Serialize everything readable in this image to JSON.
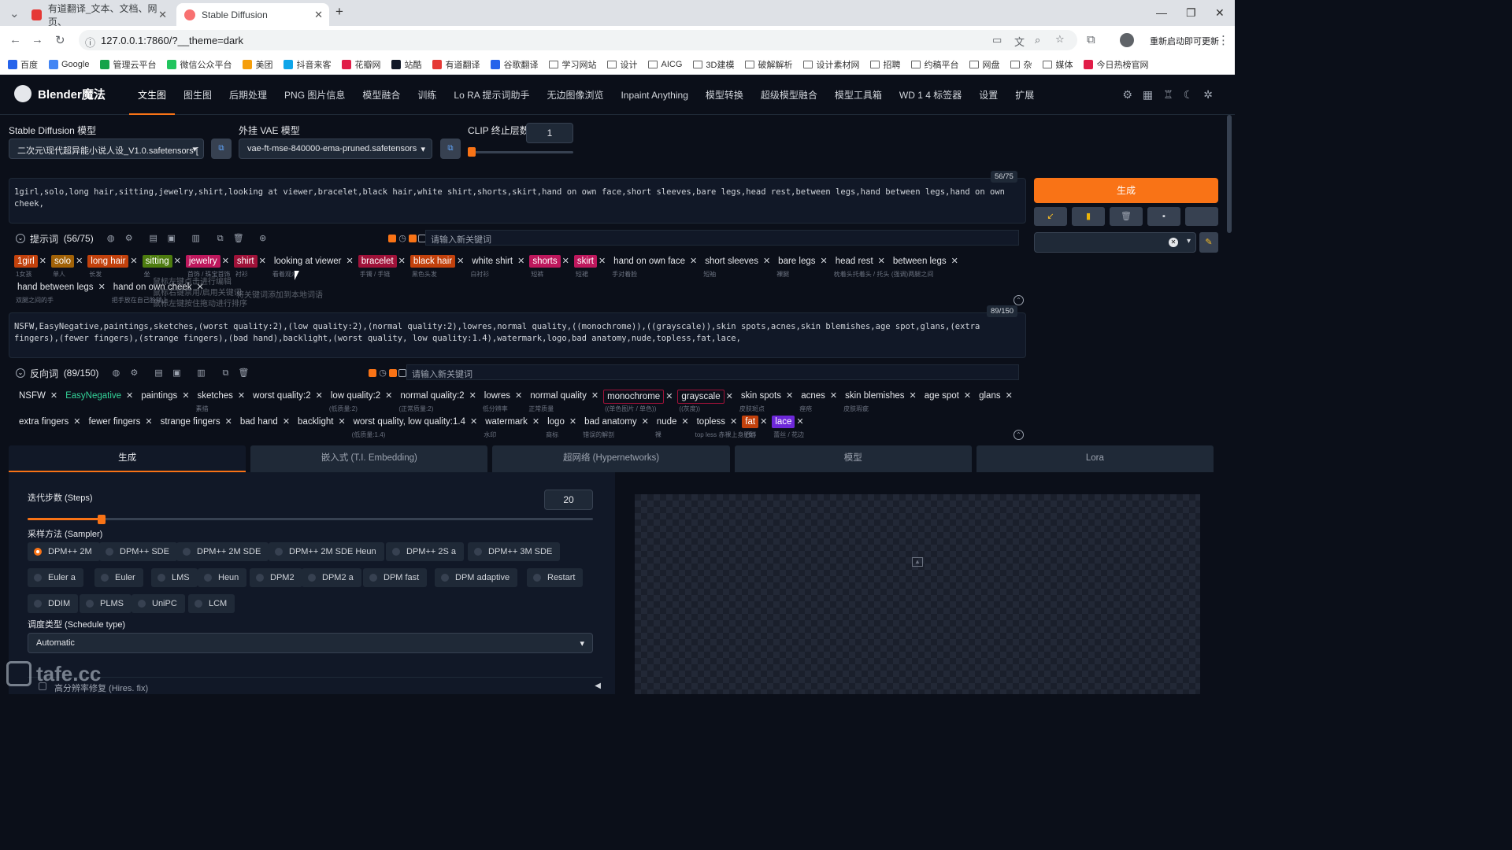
{
  "browser": {
    "tabs": [
      {
        "title": "有道翻译_文本、文档、网页、"
      },
      {
        "title": "Stable Diffusion"
      }
    ],
    "url": "127.0.0.1:7860/?__theme=dark",
    "update_label": "重新启动即可更新",
    "bookmarks": [
      "百度",
      "Google",
      "管理云平台",
      "微信公众平台",
      "美团",
      "抖音来客",
      "花瓣网",
      "站酷",
      "有道翻译",
      "谷歌翻译",
      "学习网站",
      "设计",
      "AICG",
      "3D建模",
      "破解解析",
      "设计素材网",
      "招聘",
      "约稿平台",
      "网盘",
      "杂",
      "媒体",
      "今日热榜官网"
    ]
  },
  "app": {
    "logo": "Blender魔法",
    "nav": [
      "文生图",
      "图生图",
      "后期处理",
      "PNG 图片信息",
      "模型融合",
      "训练",
      "Lo RA 提示词助手",
      "无边图像浏览",
      "Inpaint Anything",
      "模型转换",
      "超级模型融合",
      "模型工具箱",
      "WD 1 4 标签器",
      "设置",
      "扩展"
    ],
    "sd_model_label": "Stable Diffusion 模型",
    "sd_model_value": "二次元\\现代超异能小说人设_V1.0.safetensors [",
    "vae_label": "外挂 VAE 模型",
    "vae_value": "vae-ft-mse-840000-ema-pruned.safetensors",
    "clip_label": "CLIP 终止层数",
    "clip_value": "1",
    "clip_fraction": 0.0
  },
  "prompt": {
    "text": "1girl,solo,long hair,sitting,jewelry,shirt,looking at viewer,bracelet,black hair,white shirt,shorts,skirt,hand on own face,short sleeves,bare legs,head rest,between legs,hand between legs,hand on own cheek,",
    "counter": "56/75",
    "title": "提示词",
    "count": "(56/75)",
    "kw_placeholder": "请输入新关键词",
    "tags_row1": [
      {
        "t": "1girl",
        "s": "1女孩",
        "c": "orange"
      },
      {
        "t": "solo",
        "s": "单人",
        "c": "gold"
      },
      {
        "t": "long hair",
        "s": "长发",
        "c": "orange"
      },
      {
        "t": "sitting",
        "s": "坐",
        "c": "olive"
      },
      {
        "t": "jewelry",
        "s": "首饰 / 珠宝首饰",
        "c": "pink"
      },
      {
        "t": "shirt",
        "s": "衬衫",
        "c": "red"
      },
      {
        "t": "looking at viewer",
        "s": "看着观众",
        "c": ""
      },
      {
        "t": "bracelet",
        "s": "手镯 / 手链",
        "c": "red"
      },
      {
        "t": "black hair",
        "s": "黑色头发",
        "c": "orange"
      },
      {
        "t": "white shirt",
        "s": "白衬衫",
        "c": ""
      },
      {
        "t": "shorts",
        "s": "短裤",
        "c": "pink"
      },
      {
        "t": "skirt",
        "s": "短裙",
        "c": "pink"
      },
      {
        "t": "hand on own face",
        "s": "手对着脸",
        "c": ""
      },
      {
        "t": "short sleeves",
        "s": "短袖",
        "c": ""
      },
      {
        "t": "bare legs",
        "s": "裸腿",
        "c": ""
      },
      {
        "t": "head rest",
        "s": "枕着头托着头 / 托头",
        "c": ""
      },
      {
        "t": "between legs",
        "s": "(强调)两腿之间",
        "c": ""
      }
    ],
    "tags_row2": [
      {
        "t": "hand between legs",
        "s": "双腿之间的手",
        "c": ""
      },
      {
        "t": "hand on own cheek",
        "s": "把手放在自己脸颊上",
        "c": ""
      }
    ],
    "tooltips": [
      "鼠标左键点击进行编辑",
      "鼠标右键禁用/启用关键词",
      "鼠标左键按住拖动进行排序",
      "将关键词添加到本地词语"
    ]
  },
  "negative": {
    "text": "NSFW,EasyNegative,paintings,sketches,(worst quality:2),(low quality:2),(normal quality:2),lowres,normal quality,((monochrome)),((grayscale)),skin spots,acnes,skin blemishes,age spot,glans,(extra fingers),(fewer fingers),(strange fingers),(bad hand),backlight,(worst quality, low quality:1.4),watermark,logo,bad anatomy,nude,topless,fat,lace,",
    "counter": "89/150",
    "title": "反向词",
    "count": "(89/150)",
    "kw_placeholder": "请输入新关键词",
    "tags_row1": [
      {
        "t": "NSFW",
        "s": "",
        "c": ""
      },
      {
        "t": "EasyNegative",
        "s": "",
        "c": "green"
      },
      {
        "t": "paintings",
        "s": "",
        "c": ""
      },
      {
        "t": "sketches",
        "s": "素描",
        "c": ""
      },
      {
        "t": "worst quality:2",
        "s": "",
        "c": ""
      },
      {
        "t": "low quality:2",
        "s": "(低质量:2)",
        "c": ""
      },
      {
        "t": "normal quality:2",
        "s": "(正常质量:2)",
        "c": ""
      },
      {
        "t": "lowres",
        "s": "低分辨率",
        "c": ""
      },
      {
        "t": "normal quality",
        "s": "正常质量",
        "c": ""
      },
      {
        "t": "monochrome",
        "s": "((单色图片 / 单色))",
        "c": "box"
      },
      {
        "t": "grayscale",
        "s": "((灰度))",
        "c": "box"
      },
      {
        "t": "skin spots",
        "s": "皮肤斑点",
        "c": ""
      },
      {
        "t": "acnes",
        "s": "痤疮",
        "c": ""
      },
      {
        "t": "skin blemishes",
        "s": "皮肤瑕疵",
        "c": ""
      },
      {
        "t": "age spot",
        "s": "",
        "c": ""
      },
      {
        "t": "glans",
        "s": "",
        "c": ""
      }
    ],
    "tags_row2": [
      {
        "t": "extra fingers",
        "s": "",
        "c": ""
      },
      {
        "t": "fewer fingers",
        "s": "",
        "c": ""
      },
      {
        "t": "strange fingers",
        "s": "",
        "c": ""
      },
      {
        "t": "bad hand",
        "s": "",
        "c": ""
      },
      {
        "t": "backlight",
        "s": "",
        "c": ""
      },
      {
        "t": "worst quality, low quality:1.4",
        "s": "(低质量:1.4)",
        "c": ""
      },
      {
        "t": "watermark",
        "s": "水印",
        "c": ""
      },
      {
        "t": "logo",
        "s": "商标",
        "c": ""
      },
      {
        "t": "bad anatomy",
        "s": "错误的解剖",
        "c": ""
      },
      {
        "t": "nude",
        "s": "裸",
        "c": ""
      },
      {
        "t": "topless",
        "s": "top less 赤裸上身 (女)",
        "c": ""
      },
      {
        "t": "fat",
        "s": "肥胖",
        "c": "orange"
      },
      {
        "t": "lace",
        "s": "蕾丝 / 花边",
        "c": "purple"
      }
    ]
  },
  "right": {
    "generate": "生成",
    "btn_icons": [
      "↙",
      "▮",
      "🗑",
      "▪",
      ""
    ]
  },
  "subtabs": [
    "生成",
    "嵌入式 (T.I. Embedding)",
    "超网络 (Hypernetworks)",
    "模型",
    "Lora"
  ],
  "settings": {
    "steps_label": "迭代步数 (Steps)",
    "steps_value": "20",
    "steps_fraction": 0.13,
    "sampler_label": "采样方法 (Sampler)",
    "samplers": [
      "DPM++ 2M",
      "DPM++ SDE",
      "DPM++ 2M SDE",
      "DPM++ 2M SDE Heun",
      "DPM++ 2S a",
      "DPM++ 3M SDE",
      "Euler a",
      "Euler",
      "LMS",
      "Heun",
      "DPM2",
      "DPM2 a",
      "DPM fast",
      "DPM adaptive",
      "Restart",
      "DDIM",
      "PLMS",
      "UniPC",
      "LCM"
    ],
    "sampler_selected": "DPM++ 2M",
    "schedule_label": "调度类型 (Schedule type)",
    "schedule_value": "Automatic",
    "hires_label": "高分辨率修复 (Hires. fix)"
  },
  "watermark": "tafe.cc"
}
